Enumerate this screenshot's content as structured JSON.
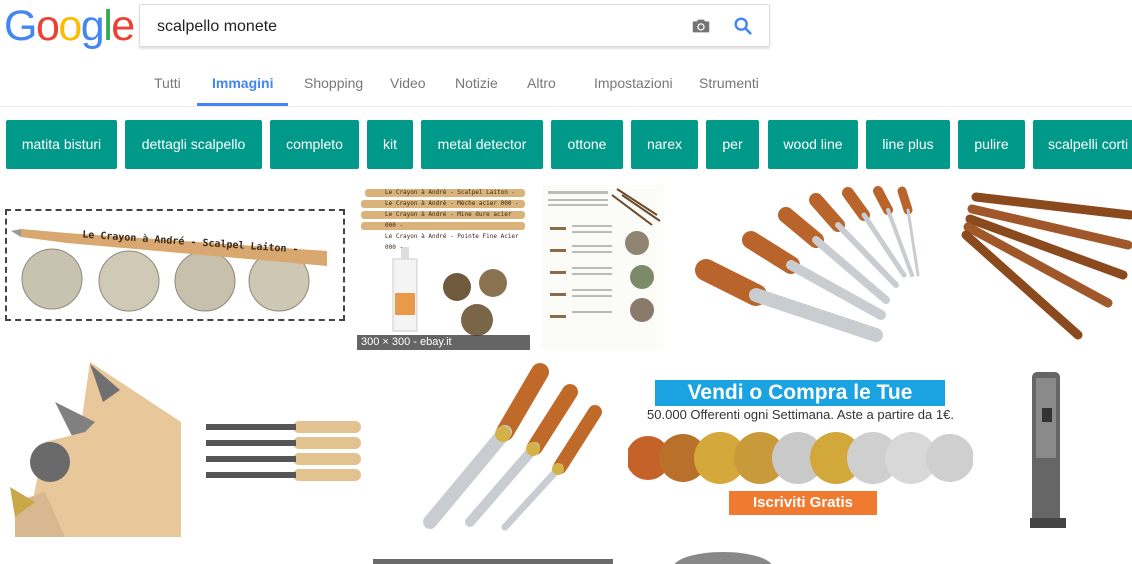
{
  "logo": {
    "letters": [
      "G",
      "o",
      "o",
      "g",
      "l",
      "e"
    ],
    "colors": [
      "#4285f4",
      "#ea4335",
      "#fbbc05",
      "#4285f4",
      "#34a853",
      "#ea4335"
    ]
  },
  "search": {
    "value": "scalpello monete",
    "camera_icon": "camera-icon",
    "search_icon": "magnifier-icon"
  },
  "tabs": [
    "Tutti",
    "Immagini",
    "Shopping",
    "Video",
    "Notizie",
    "Altro",
    "Impostazioni",
    "Strumenti"
  ],
  "active_tab": "Immagini",
  "chips": [
    "matita bisturi",
    "dettagli scalpello",
    "completo",
    "kit",
    "metal detector",
    "ottone",
    "narex",
    "per",
    "wood line",
    "line plus",
    "pulire",
    "scalpelli corti"
  ],
  "chip_color": "#00998a",
  "results": {
    "hover_caption": "300 × 300 - ebay.it",
    "pencil_label": "Le Crayon à André - Scalpel Laiton -",
    "pencils_labels": [
      "Le Crayon à André - Scalpel Laiton -",
      "Le Crayon à André - Mèche acier 000 -",
      "Le Crayon à André - Mine dure acier 000 -",
      "Le Crayon à André - Pointe Fine Acier 000 -"
    ],
    "banner": {
      "title": "Vendi o Compra le Tue Monete",
      "subtitle": "50.000 Offerenti ogni Settimana. Aste a partire da 1€.",
      "button": "Iscriviti Gratis"
    }
  }
}
